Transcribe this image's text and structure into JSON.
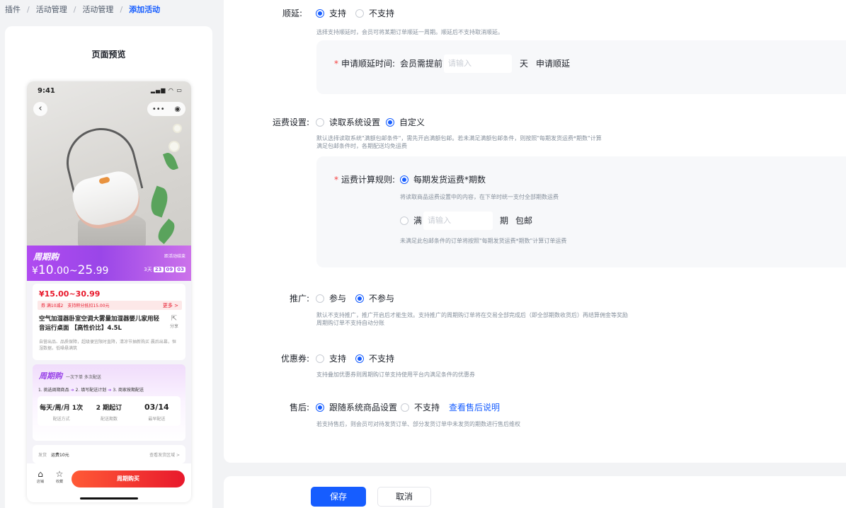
{
  "breadcrumb": {
    "items": [
      "插件",
      "活动管理",
      "活动管理"
    ],
    "current": "添加活动"
  },
  "preview": {
    "title": "页面预览",
    "status_time": "9:41",
    "status_icons": "▂▄▆ ◠ ▭",
    "capsule_more": "•••",
    "capsule_target": "◉",
    "back_glyph": "‹",
    "promo": {
      "brand": "周期购",
      "price_prefix": "¥",
      "price_main": "10",
      "price_frac": ".00~",
      "price_main2": "25",
      "price_frac2": ".99",
      "end_text": "距活动结束",
      "countdown_days": "3天",
      "countdown_h": "23",
      "countdown_m": "09",
      "countdown_s": "03"
    },
    "product": {
      "price": "¥15.00~30.99",
      "tag_coupon": "券 满10减2",
      "tag_points": "支持积分抵扣15.00元",
      "more": "更多 >",
      "title": "空气加湿器卧室空调大雾量加湿器婴儿家用轻音运行桌面 【高性价比】4.5L",
      "share": "分享",
      "desc": "自营出品、品质保障，超级便宜限时直降，清凉节抽新购买 晨后出幕，恒湿数据，低噪悬满筑"
    },
    "cycle": {
      "brand": "周期购",
      "sub": "一次下单 多次配送",
      "step1": "1. 挑选周期商品",
      "step2": "2. 填写配送计划",
      "step3": "3. 商家按期配送",
      "cells": [
        {
          "value": "每天/周/月 1次",
          "label": "配送方式"
        },
        {
          "value": "2 期起订",
          "label": "配送期数"
        },
        {
          "value": "03/14",
          "label": "最早配送"
        }
      ]
    },
    "shipping": {
      "label": "发货",
      "value": "运费10元",
      "link": "查看发货区域 >"
    },
    "bottom": {
      "shop_glyph": "⌂",
      "shop_label": "店铺",
      "fav_glyph": "☆",
      "fav_label": "收藏",
      "buy_label": "周期购买"
    }
  },
  "form": {
    "delay": {
      "label": "顺延:",
      "opt_yes": "支持",
      "opt_no": "不支持",
      "help": "选择支持顺延时，会员可将某期订单顺延一周期。顺延后不支持取消顺延。",
      "time_label": "申请顺延时间:",
      "time_prefix": "会员需提前",
      "time_placeholder": "请输入",
      "time_unit": "天",
      "time_suffix": "申请顺延"
    },
    "freight": {
      "label": "运费设置:",
      "opt_system": "读取系统设置",
      "opt_custom": "自定义",
      "help1": "默认选择读取系统\"满额包邮条件\"，需先开启满额包邮。若未满足满额包邮条件，则按照\"每期发货运费*期数\"计算",
      "help2": "满足包邮条件时，各期配送均免运费",
      "rule_label": "运费计算规则:",
      "rule_option": "每期发货运费*期数",
      "rule_help": "将读取商品运费设置中的内容，在下单时统一支付全部期数运费",
      "full_prefix": "满",
      "full_placeholder": "请输入",
      "full_unit": "期",
      "full_suffix": "包邮",
      "full_help": "未满足此包邮条件的订单将按照\"每期发货运费*期数\"计算订单运费"
    },
    "promotion": {
      "label": "推广:",
      "opt_join": "参与",
      "opt_not": "不参与",
      "help1": "默认不支持推广，推广开启后才能生效。支持推广的周期购订单将在交易全部完成后（即全部期数收货后）再结算佣金等奖励",
      "help2": "周期购订单不支持自动分账"
    },
    "coupon": {
      "label": "优惠券:",
      "opt_yes": "支持",
      "opt_no": "不支持",
      "help": "支持叠加优惠券则周期购订单支持使用平台内满足条件的优惠券"
    },
    "aftersale": {
      "label": "售后:",
      "opt_follow": "跟随系统商品设置",
      "opt_no": "不支持",
      "link": "查看售后说明",
      "help": "若支持售后，则会员可对待发货订单、部分发货订单中未发货的期数进行售后维权"
    }
  },
  "footer": {
    "save": "保存",
    "cancel": "取消"
  },
  "colors": {
    "primary": "#165dff",
    "danger": "#f53f3f",
    "promo_purple": "#9a46e8",
    "price_red": "#e8192c"
  }
}
